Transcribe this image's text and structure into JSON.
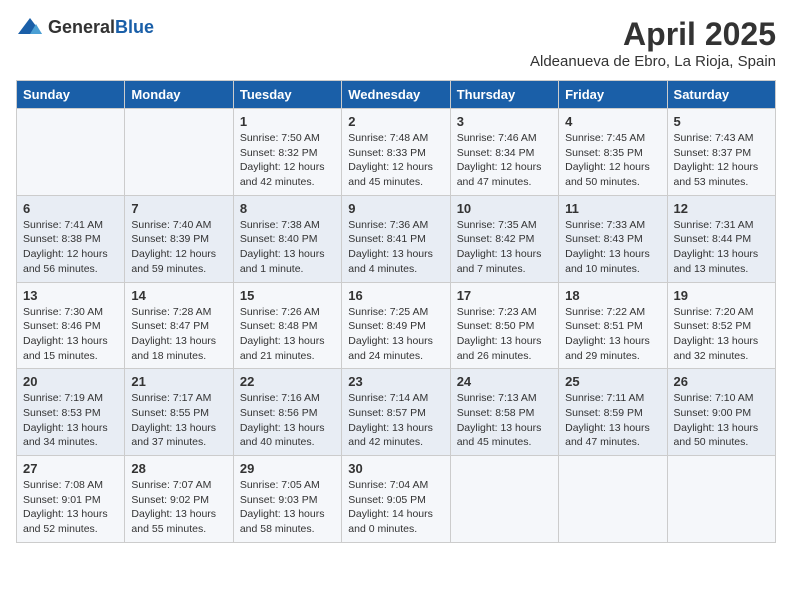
{
  "header": {
    "logo_general": "General",
    "logo_blue": "Blue",
    "month": "April 2025",
    "location": "Aldeanueva de Ebro, La Rioja, Spain"
  },
  "days_of_week": [
    "Sunday",
    "Monday",
    "Tuesday",
    "Wednesday",
    "Thursday",
    "Friday",
    "Saturday"
  ],
  "weeks": [
    [
      {
        "day": "",
        "sunrise": "",
        "sunset": "",
        "daylight": ""
      },
      {
        "day": "",
        "sunrise": "",
        "sunset": "",
        "daylight": ""
      },
      {
        "day": "1",
        "sunrise": "Sunrise: 7:50 AM",
        "sunset": "Sunset: 8:32 PM",
        "daylight": "Daylight: 12 hours and 42 minutes."
      },
      {
        "day": "2",
        "sunrise": "Sunrise: 7:48 AM",
        "sunset": "Sunset: 8:33 PM",
        "daylight": "Daylight: 12 hours and 45 minutes."
      },
      {
        "day": "3",
        "sunrise": "Sunrise: 7:46 AM",
        "sunset": "Sunset: 8:34 PM",
        "daylight": "Daylight: 12 hours and 47 minutes."
      },
      {
        "day": "4",
        "sunrise": "Sunrise: 7:45 AM",
        "sunset": "Sunset: 8:35 PM",
        "daylight": "Daylight: 12 hours and 50 minutes."
      },
      {
        "day": "5",
        "sunrise": "Sunrise: 7:43 AM",
        "sunset": "Sunset: 8:37 PM",
        "daylight": "Daylight: 12 hours and 53 minutes."
      }
    ],
    [
      {
        "day": "6",
        "sunrise": "Sunrise: 7:41 AM",
        "sunset": "Sunset: 8:38 PM",
        "daylight": "Daylight: 12 hours and 56 minutes."
      },
      {
        "day": "7",
        "sunrise": "Sunrise: 7:40 AM",
        "sunset": "Sunset: 8:39 PM",
        "daylight": "Daylight: 12 hours and 59 minutes."
      },
      {
        "day": "8",
        "sunrise": "Sunrise: 7:38 AM",
        "sunset": "Sunset: 8:40 PM",
        "daylight": "Daylight: 13 hours and 1 minute."
      },
      {
        "day": "9",
        "sunrise": "Sunrise: 7:36 AM",
        "sunset": "Sunset: 8:41 PM",
        "daylight": "Daylight: 13 hours and 4 minutes."
      },
      {
        "day": "10",
        "sunrise": "Sunrise: 7:35 AM",
        "sunset": "Sunset: 8:42 PM",
        "daylight": "Daylight: 13 hours and 7 minutes."
      },
      {
        "day": "11",
        "sunrise": "Sunrise: 7:33 AM",
        "sunset": "Sunset: 8:43 PM",
        "daylight": "Daylight: 13 hours and 10 minutes."
      },
      {
        "day": "12",
        "sunrise": "Sunrise: 7:31 AM",
        "sunset": "Sunset: 8:44 PM",
        "daylight": "Daylight: 13 hours and 13 minutes."
      }
    ],
    [
      {
        "day": "13",
        "sunrise": "Sunrise: 7:30 AM",
        "sunset": "Sunset: 8:46 PM",
        "daylight": "Daylight: 13 hours and 15 minutes."
      },
      {
        "day": "14",
        "sunrise": "Sunrise: 7:28 AM",
        "sunset": "Sunset: 8:47 PM",
        "daylight": "Daylight: 13 hours and 18 minutes."
      },
      {
        "day": "15",
        "sunrise": "Sunrise: 7:26 AM",
        "sunset": "Sunset: 8:48 PM",
        "daylight": "Daylight: 13 hours and 21 minutes."
      },
      {
        "day": "16",
        "sunrise": "Sunrise: 7:25 AM",
        "sunset": "Sunset: 8:49 PM",
        "daylight": "Daylight: 13 hours and 24 minutes."
      },
      {
        "day": "17",
        "sunrise": "Sunrise: 7:23 AM",
        "sunset": "Sunset: 8:50 PM",
        "daylight": "Daylight: 13 hours and 26 minutes."
      },
      {
        "day": "18",
        "sunrise": "Sunrise: 7:22 AM",
        "sunset": "Sunset: 8:51 PM",
        "daylight": "Daylight: 13 hours and 29 minutes."
      },
      {
        "day": "19",
        "sunrise": "Sunrise: 7:20 AM",
        "sunset": "Sunset: 8:52 PM",
        "daylight": "Daylight: 13 hours and 32 minutes."
      }
    ],
    [
      {
        "day": "20",
        "sunrise": "Sunrise: 7:19 AM",
        "sunset": "Sunset: 8:53 PM",
        "daylight": "Daylight: 13 hours and 34 minutes."
      },
      {
        "day": "21",
        "sunrise": "Sunrise: 7:17 AM",
        "sunset": "Sunset: 8:55 PM",
        "daylight": "Daylight: 13 hours and 37 minutes."
      },
      {
        "day": "22",
        "sunrise": "Sunrise: 7:16 AM",
        "sunset": "Sunset: 8:56 PM",
        "daylight": "Daylight: 13 hours and 40 minutes."
      },
      {
        "day": "23",
        "sunrise": "Sunrise: 7:14 AM",
        "sunset": "Sunset: 8:57 PM",
        "daylight": "Daylight: 13 hours and 42 minutes."
      },
      {
        "day": "24",
        "sunrise": "Sunrise: 7:13 AM",
        "sunset": "Sunset: 8:58 PM",
        "daylight": "Daylight: 13 hours and 45 minutes."
      },
      {
        "day": "25",
        "sunrise": "Sunrise: 7:11 AM",
        "sunset": "Sunset: 8:59 PM",
        "daylight": "Daylight: 13 hours and 47 minutes."
      },
      {
        "day": "26",
        "sunrise": "Sunrise: 7:10 AM",
        "sunset": "Sunset: 9:00 PM",
        "daylight": "Daylight: 13 hours and 50 minutes."
      }
    ],
    [
      {
        "day": "27",
        "sunrise": "Sunrise: 7:08 AM",
        "sunset": "Sunset: 9:01 PM",
        "daylight": "Daylight: 13 hours and 52 minutes."
      },
      {
        "day": "28",
        "sunrise": "Sunrise: 7:07 AM",
        "sunset": "Sunset: 9:02 PM",
        "daylight": "Daylight: 13 hours and 55 minutes."
      },
      {
        "day": "29",
        "sunrise": "Sunrise: 7:05 AM",
        "sunset": "Sunset: 9:03 PM",
        "daylight": "Daylight: 13 hours and 58 minutes."
      },
      {
        "day": "30",
        "sunrise": "Sunrise: 7:04 AM",
        "sunset": "Sunset: 9:05 PM",
        "daylight": "Daylight: 14 hours and 0 minutes."
      },
      {
        "day": "",
        "sunrise": "",
        "sunset": "",
        "daylight": ""
      },
      {
        "day": "",
        "sunrise": "",
        "sunset": "",
        "daylight": ""
      },
      {
        "day": "",
        "sunrise": "",
        "sunset": "",
        "daylight": ""
      }
    ]
  ]
}
